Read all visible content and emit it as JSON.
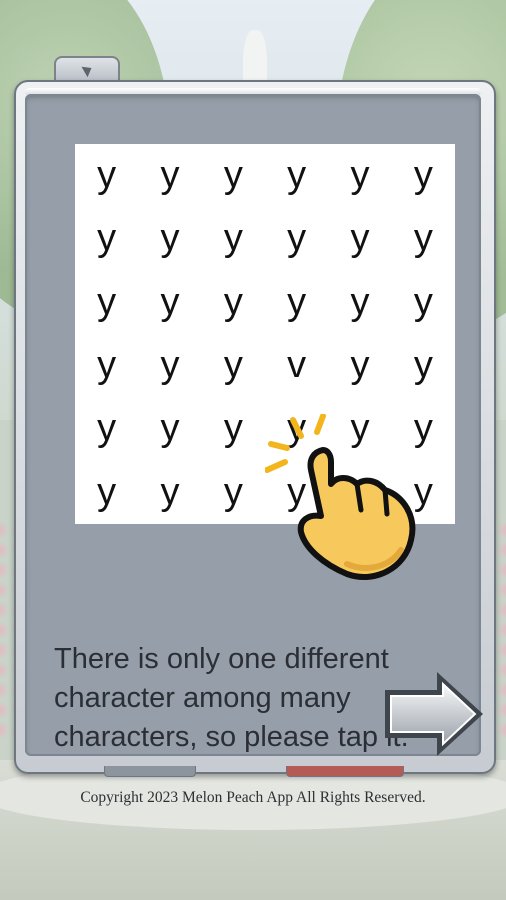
{
  "puzzle": {
    "grid": [
      [
        "y",
        "y",
        "y",
        "y",
        "y",
        "y"
      ],
      [
        "y",
        "y",
        "y",
        "y",
        "y",
        "y"
      ],
      [
        "y",
        "y",
        "y",
        "y",
        "y",
        "y"
      ],
      [
        "y",
        "y",
        "y",
        "v",
        "y",
        "y"
      ],
      [
        "y",
        "y",
        "y",
        "y",
        "y",
        "y"
      ],
      [
        "y",
        "y",
        "y",
        "y",
        "y",
        "y"
      ]
    ]
  },
  "instruction_text": "There is only one different character among many characters, so please tap it.",
  "icons": {
    "pointer": "tapping-hand-icon",
    "next": "right-arrow-icon"
  },
  "colors": {
    "panel": "#959ea9",
    "grid_background": "#ffffff",
    "hand": "#f7c95c",
    "tap_rays": "#f2b61c"
  },
  "footer": {
    "copyright": "Copyright 2023 Melon Peach App All Rights Reserved."
  }
}
